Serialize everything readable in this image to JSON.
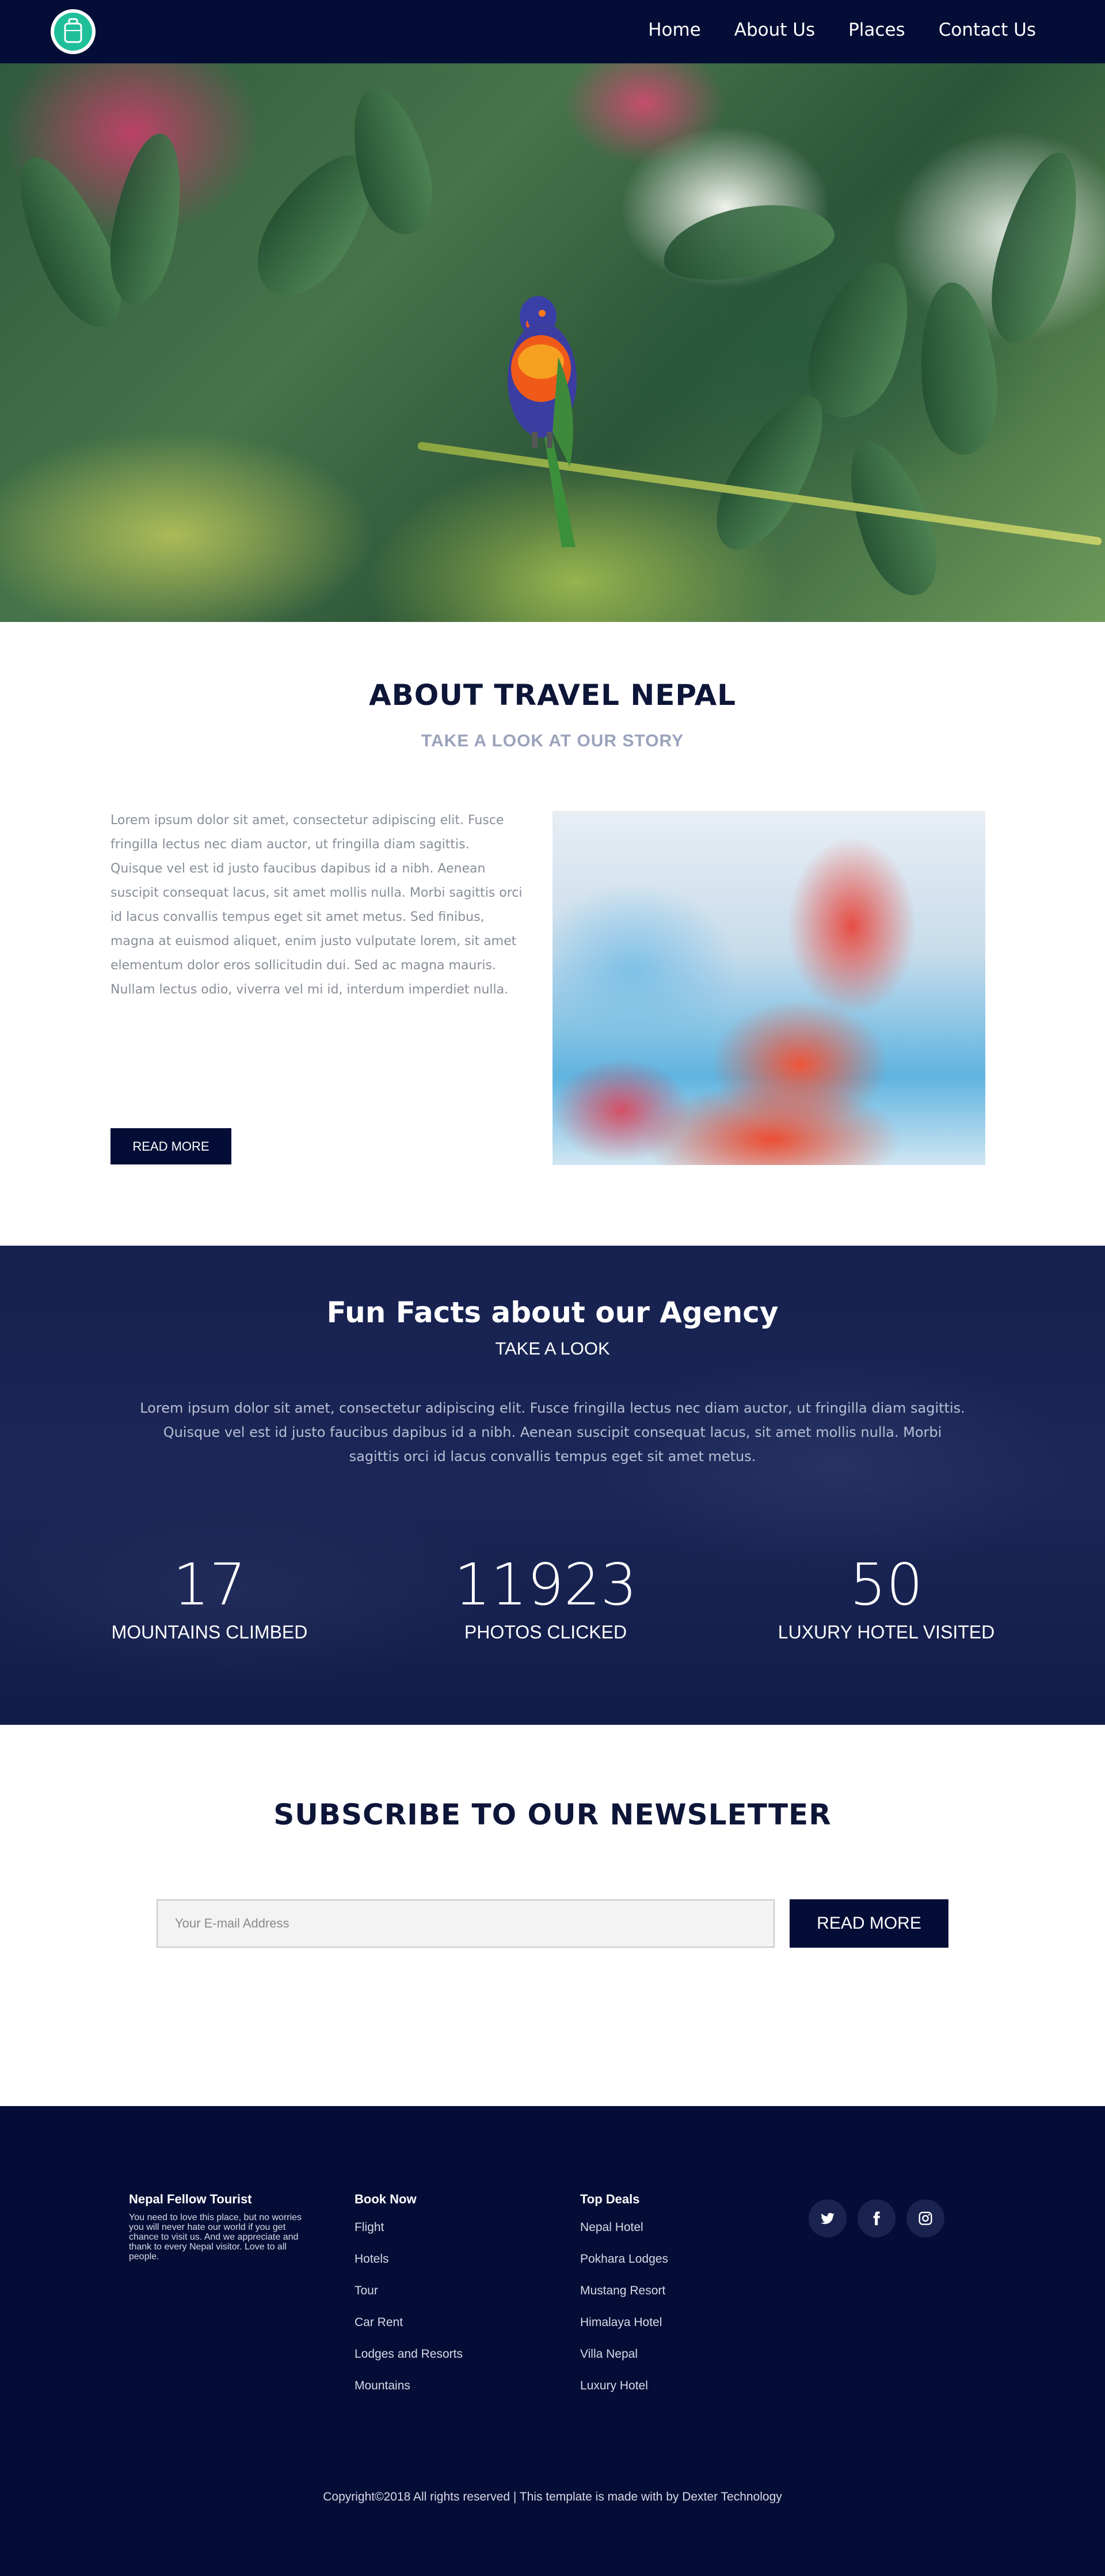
{
  "nav": {
    "items": [
      "Home",
      "About Us",
      "Places",
      "Contact Us"
    ]
  },
  "about": {
    "title": "ABOUT TRAVEL NEPAL",
    "subtitle": "TAKE A LOOK AT OUR STORY",
    "body": "Lorem ipsum dolor sit amet, consectetur adipiscing elit. Fusce fringilla lectus nec diam auctor, ut fringilla diam sagittis. Quisque vel est id justo faucibus dapibus id a nibh. Aenean suscipit consequat lacus, sit amet mollis nulla. Morbi sagittis orci id lacus convallis tempus eget sit amet metus. Sed finibus, magna at euismod aliquet, enim justo vulputate lorem, sit amet elementum dolor eros sollicitudin dui. Sed ac magna mauris. Nullam lectus odio, viverra vel mi id, interdum imperdiet nulla.",
    "button": "READ MORE"
  },
  "facts": {
    "title": "Fun Facts about our Agency",
    "subtitle": "TAKE A LOOK",
    "body": "Lorem ipsum dolor sit amet, consectetur adipiscing elit. Fusce fringilla lectus nec diam auctor, ut fringilla diam sagittis. Quisque vel est id justo faucibus dapibus id a nibh. Aenean suscipit consequat lacus, sit amet mollis nulla. Morbi sagittis orci id lacus convallis tempus eget sit amet metus.",
    "stats": [
      {
        "value": "17",
        "label": "MOUNTAINS CLIMBED"
      },
      {
        "value": "11923",
        "label": "PHOTOS CLICKED"
      },
      {
        "value": "50",
        "label": "LUXURY HOTEL VISITED"
      }
    ]
  },
  "newsletter": {
    "title": "SUBSCRIBE TO OUR NEWSLETTER",
    "placeholder": "Your E-mail Address",
    "button": "READ MORE"
  },
  "footer": {
    "about_title": "Nepal Fellow Tourist",
    "about_text": "You need to love this place, but no worries you will never hate our world if you get chance to visit us. And we appreciate and thank to every Nepal visitor. Love to all people.",
    "book_title": "Book Now",
    "book_links": [
      "Flight",
      "Hotels",
      "Tour",
      "Car Rent",
      "Lodges and Resorts",
      "Mountains"
    ],
    "deals_title": "Top Deals",
    "deals_links": [
      "Nepal Hotel",
      "Pokhara Lodges",
      "Mustang Resort",
      "Himalaya Hotel",
      "Villa Nepal",
      "Luxury Hotel"
    ],
    "social": [
      "twitter-icon",
      "facebook-icon",
      "instagram-icon"
    ],
    "copyright": "Copyright©2018 All rights reserved | This template is made with by Dexter Technology"
  },
  "colors": {
    "navy": "#040d36",
    "facts_bg": "#1b2757",
    "logo_teal": "#1fbf9a",
    "muted_text": "#888d99"
  }
}
